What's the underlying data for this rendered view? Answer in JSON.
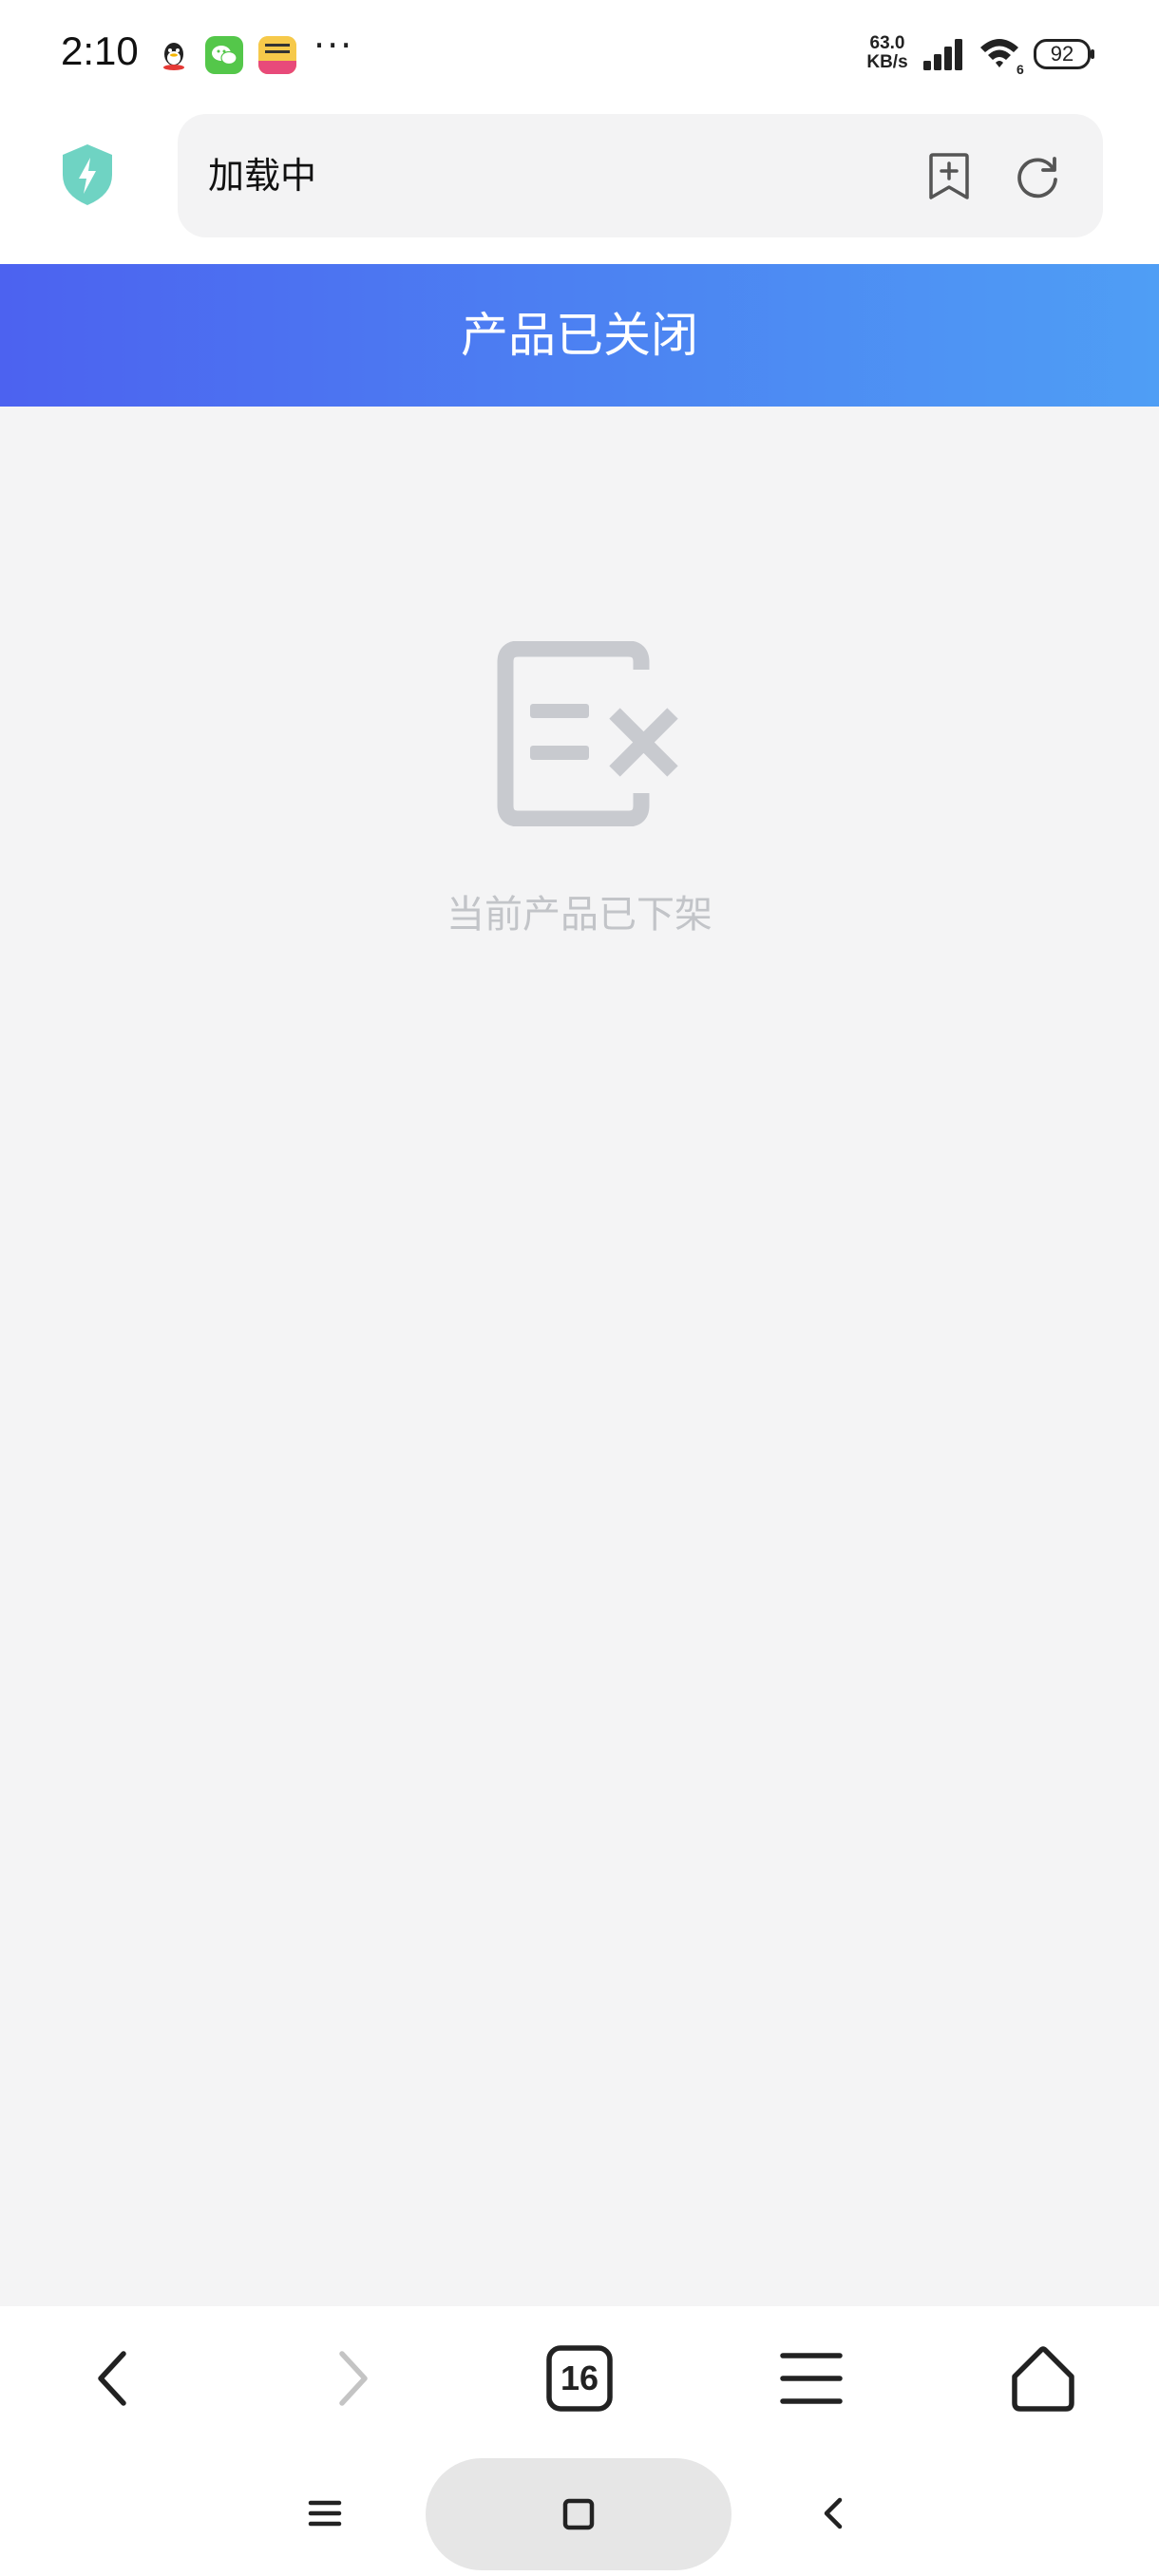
{
  "status_bar": {
    "time": "2:10",
    "notification_icons": [
      "qq-icon",
      "wechat-icon",
      "meituan-icon"
    ],
    "more": "···",
    "net_speed_value": "63.0",
    "net_speed_unit": "KB/s",
    "wifi_badge": "6",
    "battery": "92"
  },
  "browser": {
    "address_text": "加载中",
    "tabs_count": "16"
  },
  "page": {
    "title": "产品已关闭",
    "empty_message": "当前产品已下架"
  },
  "colors": {
    "header_gradient_start": "#4c62f0",
    "header_gradient_end": "#4f9ef5",
    "shield": "#6fd3c3",
    "empty_icon": "#c8cacf",
    "empty_text": "#c2c4c8"
  }
}
